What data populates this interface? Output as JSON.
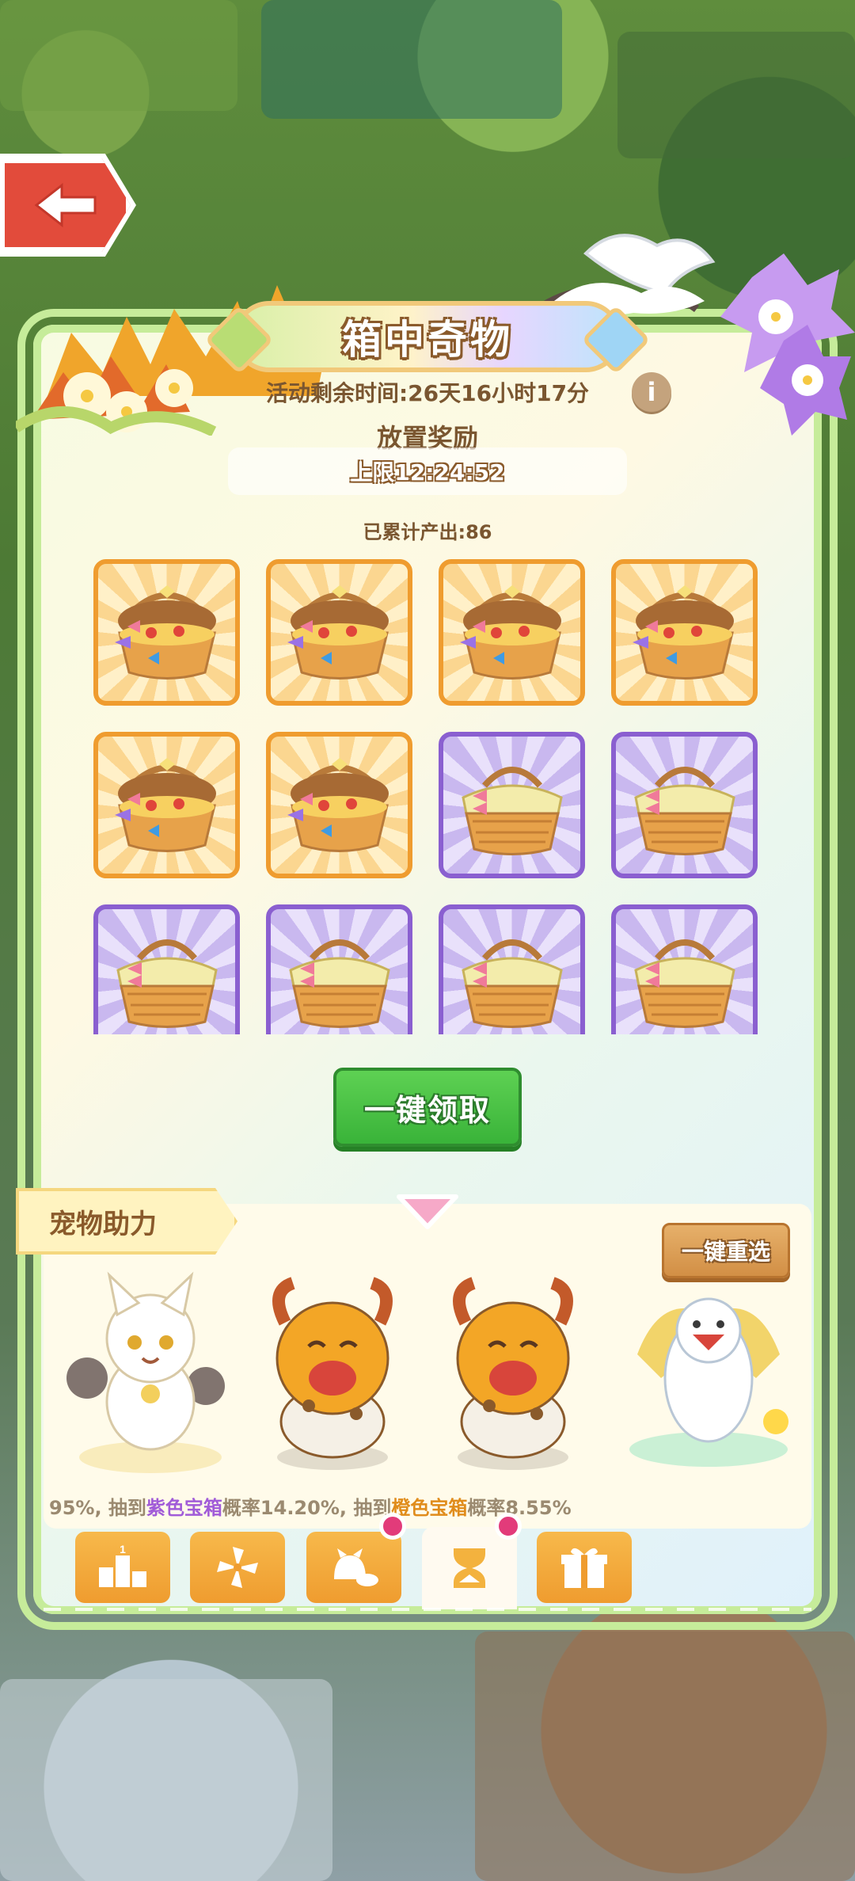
{
  "colors": {
    "accent_green": "#39b339",
    "orange_box_border": "#ef9c2f",
    "purple_box_border": "#8a5fd0",
    "title_text_outline": "#8a5a2b",
    "purple_text": "#a15bd8",
    "orange_text": "#e08c1b",
    "notification_dot": "#e23b7a"
  },
  "header": {
    "title": "箱中奇物",
    "timer": "活动剩余时间:26天16小时17分",
    "info_icon": "i"
  },
  "reward": {
    "title": "放置奖励",
    "limit": "上限12:24:52",
    "produced": "已累计产出:86"
  },
  "grid": {
    "boxes": [
      {
        "type": "orange",
        "icon": "open-picnic-basket-icon"
      },
      {
        "type": "orange",
        "icon": "open-picnic-basket-icon"
      },
      {
        "type": "orange",
        "icon": "open-picnic-basket-icon"
      },
      {
        "type": "orange",
        "icon": "open-picnic-basket-icon"
      },
      {
        "type": "orange",
        "icon": "open-picnic-basket-icon"
      },
      {
        "type": "orange",
        "icon": "open-picnic-basket-icon"
      },
      {
        "type": "purple",
        "icon": "closed-picnic-basket-icon"
      },
      {
        "type": "purple",
        "icon": "closed-picnic-basket-icon"
      },
      {
        "type": "purple",
        "icon": "closed-picnic-basket-icon"
      },
      {
        "type": "purple",
        "icon": "closed-picnic-basket-icon"
      },
      {
        "type": "purple",
        "icon": "closed-picnic-basket-icon"
      },
      {
        "type": "purple",
        "icon": "closed-picnic-basket-icon"
      }
    ]
  },
  "collect_button": {
    "label": "一键领取"
  },
  "pets": {
    "tag": "宠物助力",
    "reroll_label": "一键重选",
    "list": [
      {
        "icon": "white-fox-pet-icon"
      },
      {
        "icon": "orange-bull-pet-icon"
      },
      {
        "icon": "orange-bull-pet-icon"
      },
      {
        "icon": "white-bird-pet-icon"
      }
    ],
    "probability": {
      "p1": "95%, 抽到",
      "purple_box": "紫色宝箱",
      "p2": "概率14.20%, 抽到",
      "orange_box": "橙色宝箱",
      "p3": "概率8.55%"
    }
  },
  "tabs": [
    {
      "icon": "ranking-podium-icon",
      "podium_number": "1",
      "active": false,
      "dot": false
    },
    {
      "icon": "pinwheel-icon",
      "active": false,
      "dot": false
    },
    {
      "icon": "pet-food-icon",
      "active": false,
      "dot": true
    },
    {
      "icon": "hourglass-icon",
      "active": true,
      "dot": true
    },
    {
      "icon": "gift-box-icon",
      "active": false,
      "dot": false
    }
  ]
}
